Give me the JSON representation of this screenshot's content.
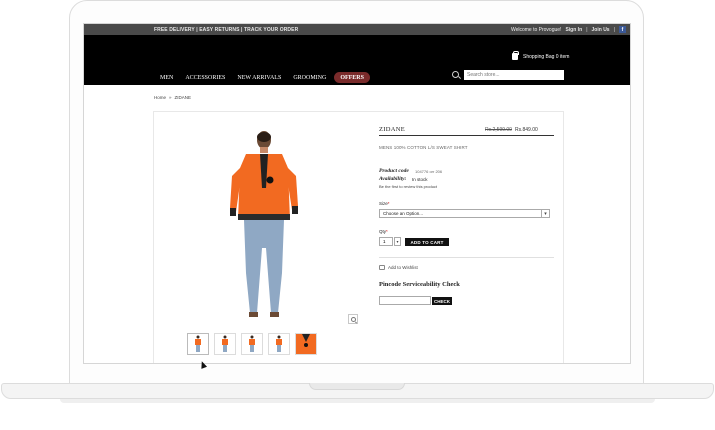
{
  "topbar": {
    "promo": "FREE DELIVERY | EASY RETURNS | TRACK YOUR ORDER",
    "welcome": "Welcome to Provogue!",
    "signin": "Sign In",
    "joinus": "Join Us",
    "fb": "f"
  },
  "header": {
    "bag": "Shopping Bag 0 item",
    "nav": [
      "MEN",
      "ACCESSORIES",
      "NEW ARRIVALS",
      "GROOMING",
      "OFFERS"
    ],
    "search_placeholder": "Search store..."
  },
  "breadcrumb": {
    "home": "Home",
    "sep": "»",
    "current": "ZIDANE"
  },
  "product": {
    "name": "ZIDANE",
    "old_price": "Rs.2,599.00",
    "new_price": "Rs.849.00",
    "description": "MENS 100% COTTON L/S SWEAT SHIRT",
    "code_label": "Product code",
    "code_value": "104776 orr 206",
    "availability_label": "Availability:",
    "availability_value": "In stock",
    "review_text": "Be the first to review this product",
    "size_label": "Size",
    "size_placeholder": "Choose an Option...",
    "qty_label": "Qty",
    "qty_value": "1",
    "add_to_cart": "ADD TO CART",
    "wishlist": "Add to Wishlist",
    "pincode_title": "Pincode Serviceability Check",
    "check": "CHECK",
    "required_mark": "*"
  },
  "colors": {
    "jacket": "#f26a21",
    "header_bg": "#000000",
    "offers_bg": "#7a2b2b",
    "topbar_bg": "#4a4a4a"
  }
}
